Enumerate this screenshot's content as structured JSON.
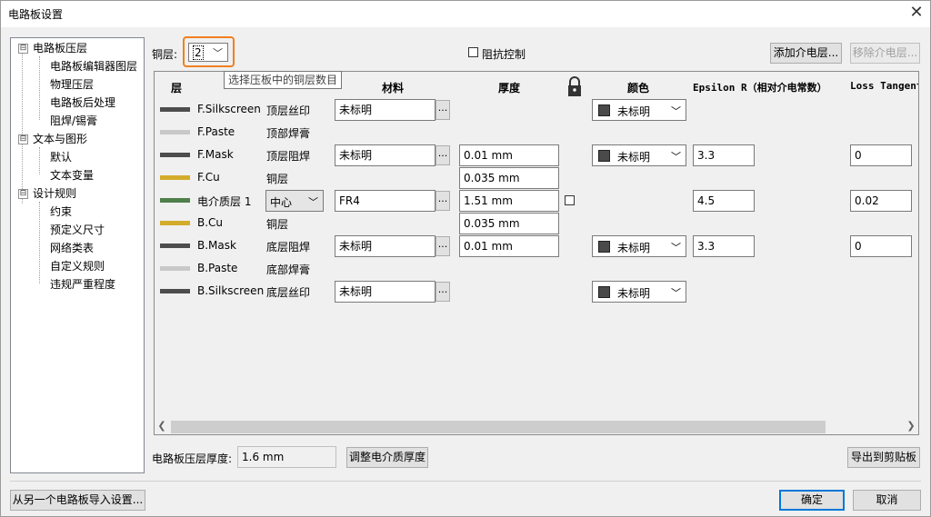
{
  "window": {
    "title": "电路板设置",
    "close_glyph": "✕"
  },
  "tree": {
    "items": [
      {
        "label": "电路板压层",
        "toggle": "⊟"
      },
      {
        "label": "电路板编辑器图层"
      },
      {
        "label": "物理压层"
      },
      {
        "label": "电路板后处理"
      },
      {
        "label": "阻焊/锡膏"
      },
      {
        "label": "文本与图形",
        "toggle": "⊟"
      },
      {
        "label": "默认"
      },
      {
        "label": "文本变量"
      },
      {
        "label": "设计规则",
        "toggle": "⊟"
      },
      {
        "label": "约束"
      },
      {
        "label": "预定义尺寸"
      },
      {
        "label": "网络类表"
      },
      {
        "label": "自定义规则"
      },
      {
        "label": "违规严重程度"
      }
    ]
  },
  "top": {
    "copper_label": "铜层:",
    "copper_value": "2",
    "tooltip": "选择压板中的铜层数目",
    "impedance_label": "阻抗控制",
    "add_dielectric": "添加介电层...",
    "remove_dielectric": "移除介电层..."
  },
  "grid": {
    "headers": {
      "layer": "层",
      "material": "材料",
      "thickness": "厚度",
      "color": "颜色",
      "epsilon": "Epsilon R（相对介电常数）",
      "loss": "Loss Tangent"
    },
    "rows": [
      {
        "swatch": "#4d4d4d",
        "name": "F.Silkscreen",
        "type": "顶层丝印",
        "material": "未标明",
        "color": "未标明"
      },
      {
        "swatch": "#c8c8c8",
        "name": "F.Paste",
        "type": "顶部焊膏"
      },
      {
        "swatch": "#4d4d4d",
        "name": "F.Mask",
        "type": "顶层阻焊",
        "material": "未标明",
        "thickness": "0.01 mm",
        "color": "未标明",
        "epsilon": "3.3",
        "loss": "0"
      },
      {
        "swatch": "#d4ac2c",
        "name": "F.Cu",
        "type": "铜层",
        "thickness": "0.035 mm"
      },
      {
        "swatch": "#4f7f4a",
        "name": "电介质层 1",
        "type_select": "中心",
        "material": "FR4",
        "thickness": "1.51 mm",
        "epsilon": "4.5",
        "loss": "0.02"
      },
      {
        "swatch": "#d4ac2c",
        "name": "B.Cu",
        "type": "铜层",
        "thickness": "0.035 mm"
      },
      {
        "swatch": "#4d4d4d",
        "name": "B.Mask",
        "type": "底层阻焊",
        "material": "未标明",
        "thickness": "0.01 mm",
        "color": "未标明",
        "epsilon": "3.3",
        "loss": "0"
      },
      {
        "swatch": "#c8c8c8",
        "name": "B.Paste",
        "type": "底部焊膏"
      },
      {
        "swatch": "#4d4d4d",
        "name": "B.Silkscreen",
        "type": "底层丝印",
        "material": "未标明",
        "color": "未标明"
      }
    ],
    "dots_label": "...",
    "chevron": "﹀"
  },
  "bottom": {
    "thickness_label": "电路板压层厚度:",
    "thickness_value": "1.6 mm",
    "adjust_button": "调整电介质厚度",
    "export_button": "导出到剪贴板",
    "import_button": "从另一个电路板导入设置...",
    "ok_button": "确定",
    "cancel_button": "取消"
  },
  "colors": {
    "accent": "#f08020",
    "default_button": "#0078d7"
  }
}
